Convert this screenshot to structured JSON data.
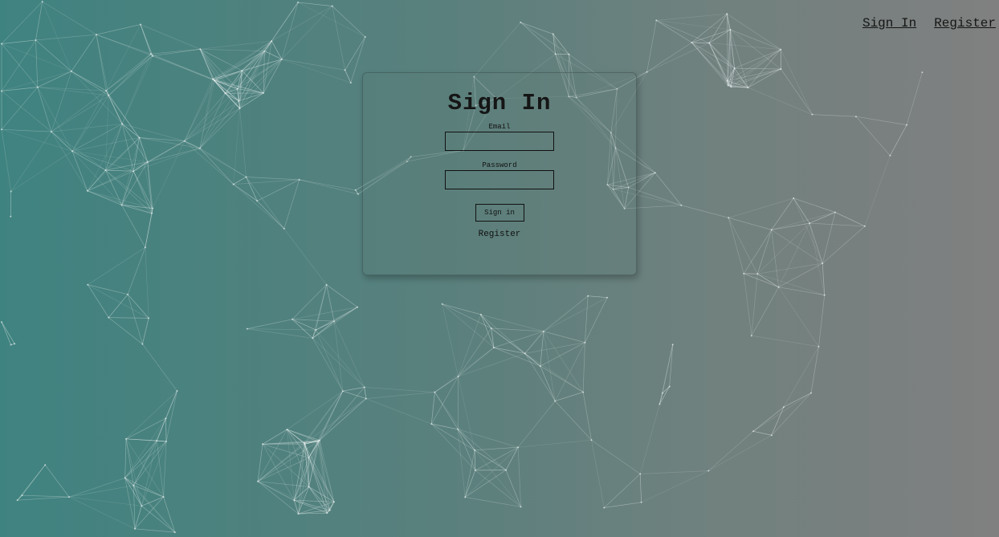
{
  "nav": {
    "sign_in": "Sign In",
    "register": "Register"
  },
  "form": {
    "title": "Sign In",
    "email_label": "Email",
    "email_value": "",
    "password_label": "Password",
    "password_value": "",
    "submit_label": "Sign in",
    "register_link": "Register"
  },
  "colors": {
    "gradient_left": "#3f8380",
    "gradient_right": "#808080",
    "network_lines": "#e8f0ef"
  }
}
